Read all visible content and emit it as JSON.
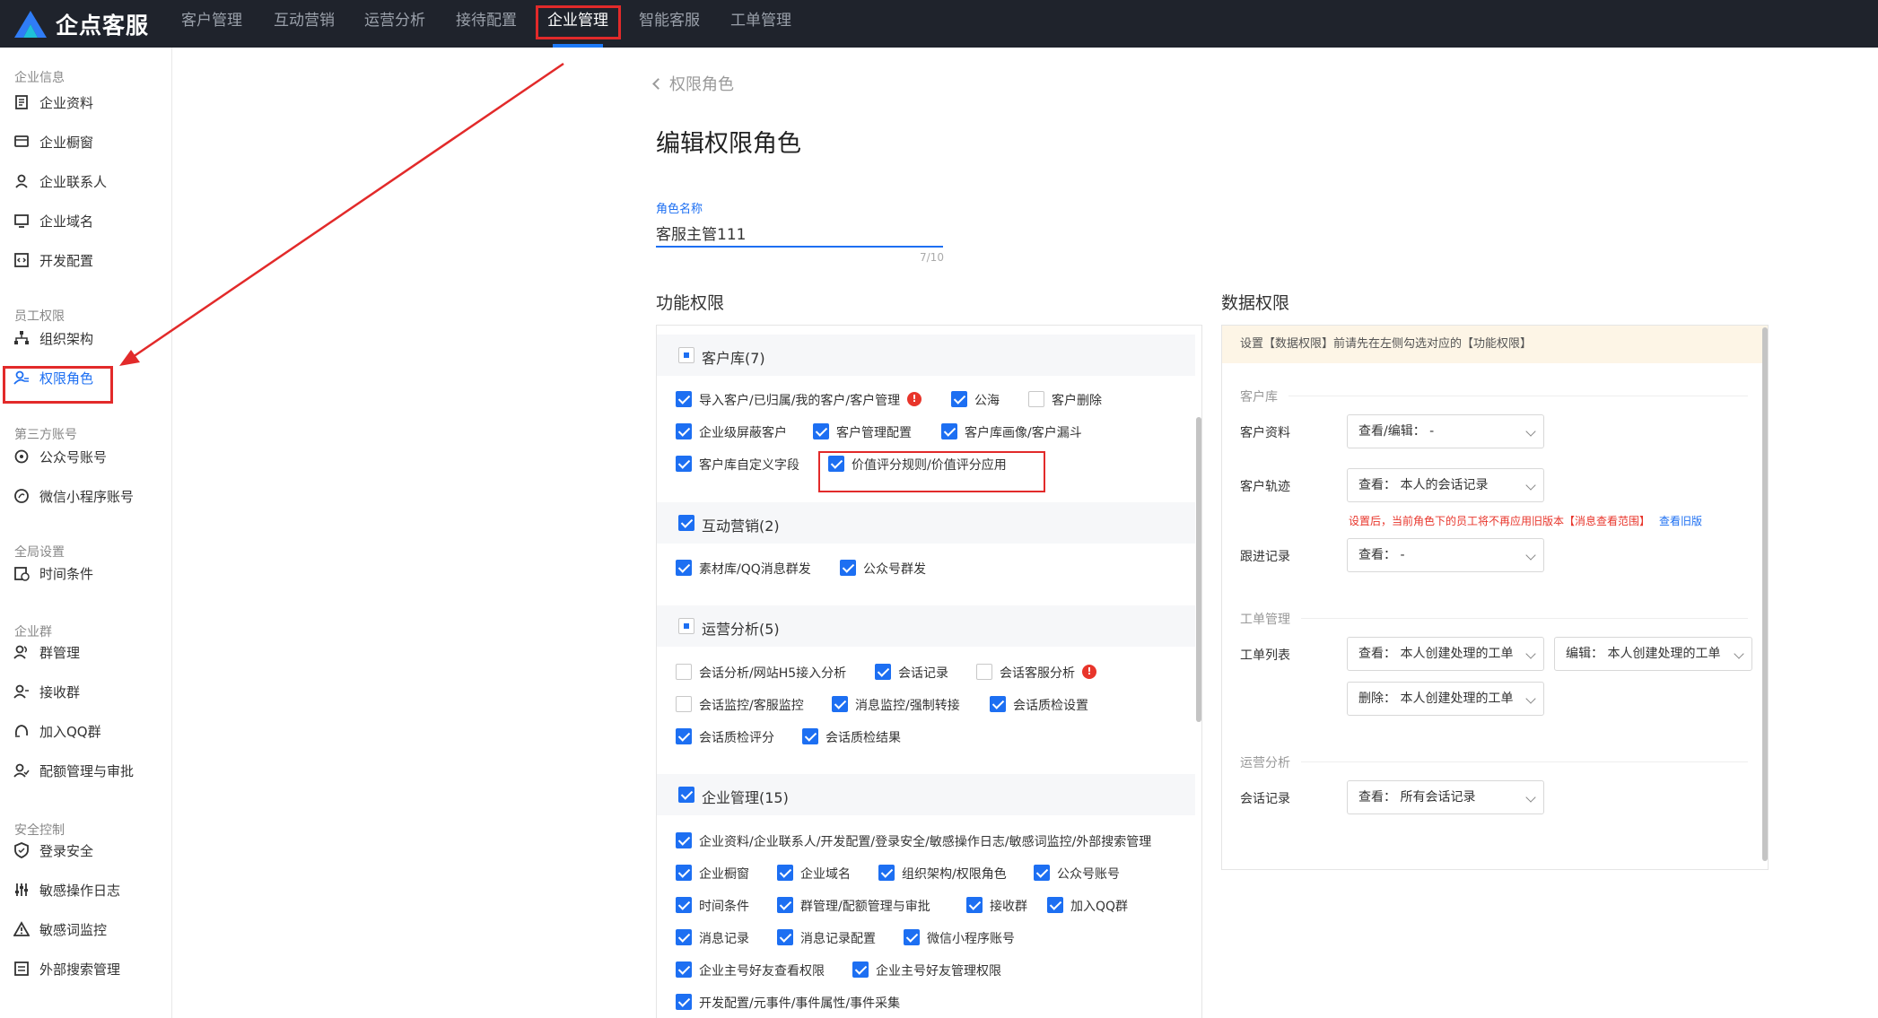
{
  "app": {
    "name": "企点客服"
  },
  "nav": {
    "items": [
      "客户管理",
      "互动营销",
      "运营分析",
      "接待配置",
      "企业管理",
      "智能客服",
      "工单管理"
    ],
    "active_index": 4
  },
  "sidebar": {
    "groups": [
      {
        "title": "企业信息",
        "items": [
          "企业资料",
          "企业橱窗",
          "企业联系人",
          "企业域名",
          "开发配置"
        ]
      },
      {
        "title": "员工权限",
        "items": [
          "组织架构",
          "权限角色"
        ]
      },
      {
        "title": "第三方账号",
        "items": [
          "公众号账号",
          "微信小程序账号"
        ]
      },
      {
        "title": "全局设置",
        "items": [
          "时间条件"
        ]
      },
      {
        "title": "企业群",
        "items": [
          "群管理",
          "接收群",
          "加入QQ群",
          "配额管理与审批"
        ]
      },
      {
        "title": "安全控制",
        "items": [
          "登录安全",
          "敏感操作日志",
          "敏感词监控",
          "外部搜索管理"
        ]
      }
    ],
    "active_item": "权限角色"
  },
  "breadcrumb": {
    "back_label": "权限角色"
  },
  "page": {
    "title": "编辑权限角色"
  },
  "role": {
    "label": "角色名称",
    "value": "客服主管111",
    "counter": "7/10"
  },
  "func": {
    "section_title": "功能权限",
    "groups": [
      {
        "label": "客户库(7)",
        "state": "partial",
        "items": [
          {
            "label": "导入客户/已归属/我的客户/客户管理",
            "checked": true,
            "warn": true
          },
          {
            "label": "公海",
            "checked": true
          },
          {
            "label": "客户删除",
            "checked": false
          },
          {
            "label": "企业级屏蔽客户",
            "checked": true
          },
          {
            "label": "客户管理配置",
            "checked": true
          },
          {
            "label": "客户库画像/客户漏斗",
            "checked": true
          },
          {
            "label": "客户库自定义字段",
            "checked": true
          },
          {
            "label": "价值评分规则/价值评分应用",
            "checked": true
          }
        ]
      },
      {
        "label": "互动营销(2)",
        "state": "checked",
        "items": [
          {
            "label": "素材库/QQ消息群发",
            "checked": true
          },
          {
            "label": "公众号群发",
            "checked": true
          }
        ]
      },
      {
        "label": "运营分析(5)",
        "state": "partial",
        "items": [
          {
            "label": "会话分析/网站H5接入分析",
            "checked": false
          },
          {
            "label": "会话记录",
            "checked": true
          },
          {
            "label": "会话客服分析",
            "checked": false,
            "warn": true
          },
          {
            "label": "会话监控/客服监控",
            "checked": false
          },
          {
            "label": "消息监控/强制转接",
            "checked": true
          },
          {
            "label": "会话质检设置",
            "checked": true
          },
          {
            "label": "会话质检评分",
            "checked": true
          },
          {
            "label": "会话质检结果",
            "checked": true
          }
        ]
      },
      {
        "label": "企业管理(15)",
        "state": "checked",
        "items": [
          {
            "label": "企业资料/企业联系人/开发配置/登录安全/敏感操作日志/敏感词监控/外部搜索管理",
            "checked": true
          },
          {
            "label": "企业橱窗",
            "checked": true
          },
          {
            "label": "企业域名",
            "checked": true
          },
          {
            "label": "组织架构/权限角色",
            "checked": true
          },
          {
            "label": "公众号账号",
            "checked": true
          },
          {
            "label": "时间条件",
            "checked": true
          },
          {
            "label": "群管理/配额管理与审批",
            "checked": true
          },
          {
            "label": "接收群",
            "checked": true
          },
          {
            "label": "加入QQ群",
            "checked": true
          },
          {
            "label": "消息记录",
            "checked": true
          },
          {
            "label": "消息记录配置",
            "checked": true
          },
          {
            "label": "微信小程序账号",
            "checked": true
          },
          {
            "label": "企业主号好友查看权限",
            "checked": true
          },
          {
            "label": "企业主号好友管理权限",
            "checked": true
          },
          {
            "label": "开发配置/元事件/事件属性/事件采集",
            "checked": true
          }
        ]
      }
    ],
    "warn_glyph": "!"
  },
  "data": {
    "section_title": "数据权限",
    "notice": "设置【数据权限】前请先在左侧勾选对应的【功能权限】",
    "sections": [
      {
        "title": "客户库",
        "rows": [
          {
            "label": "客户资料",
            "selects": [
              "查看/编辑：  -"
            ]
          },
          {
            "label": "客户轨迹",
            "selects": [
              "查看：  本人的会话记录"
            ]
          },
          {
            "label": "跟进记录",
            "selects": [
              "查看：  -"
            ]
          }
        ]
      },
      {
        "title": "工单管理",
        "rows": [
          {
            "label": "工单列表",
            "selects": [
              "查看：  本人创建处理的工单",
              "编辑：  本人创建处理的工单",
              "删除：  本人创建处理的工单"
            ]
          }
        ]
      },
      {
        "title": "运营分析",
        "rows": [
          {
            "label": "会话记录",
            "selects": [
              "查看：  所有会话记录"
            ]
          }
        ]
      }
    ],
    "tip": "设置后，当前角色下的员工将不再应用旧版本【消息查看范围】",
    "tip_link": "查看旧版"
  },
  "colors": {
    "accent": "#1d6ff2",
    "topbar": "#1f232c",
    "annotation": "#e22a2a",
    "warn": "#e8352b"
  }
}
